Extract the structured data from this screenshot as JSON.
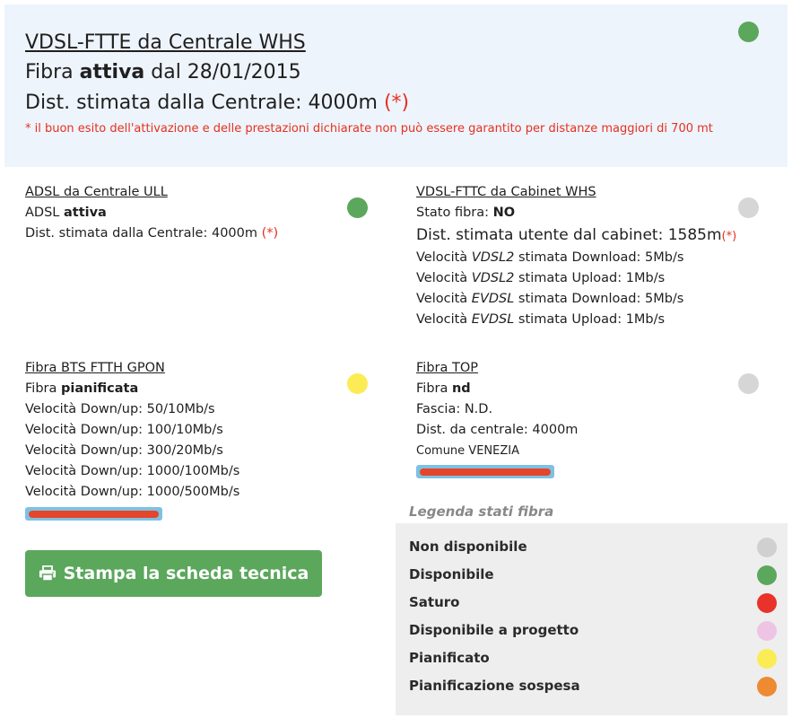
{
  "top": {
    "title": "VDSL-FTTE da Centrale WHS",
    "status_prefix": "Fibra ",
    "status_value": "attiva",
    "status_suffix": " dal 28/01/2015",
    "dist_label": "Dist. stimata dalla Centrale: 4000m ",
    "dist_mark": "(*)",
    "note": "* il buon esito dell'attivazione e delle prestazioni dichiarate non può essere garantito per distanze maggiori di 700 mt",
    "status_color": "#5ba75c"
  },
  "adsl": {
    "title": "ADSL da Centrale ULL",
    "status_prefix": "ADSL ",
    "status_value": "attiva",
    "dist_label": "Dist. stimata dalla Centrale: 4000m ",
    "dist_mark": "(*)",
    "status_color": "#5ba75c"
  },
  "vdsl": {
    "title": "VDSL-FTTC da Cabinet WHS",
    "status_prefix": "Stato fibra: ",
    "status_value": "NO",
    "dist_label": "Dist. stimata utente dal cabinet: 1585m",
    "dist_mark": "(*)",
    "speeds": [
      {
        "pre": "Velocità ",
        "tech": "VDSL2",
        "post": " stimata Download: 5Mb/s"
      },
      {
        "pre": "Velocità ",
        "tech": "VDSL2",
        "post": " stimata Upload: 1Mb/s"
      },
      {
        "pre": "Velocità ",
        "tech": "EVDSL",
        "post": " stimata Download: 5Mb/s"
      },
      {
        "pre": "Velocità ",
        "tech": "EVDSL",
        "post": " stimata Upload: 1Mb/s"
      }
    ],
    "status_color": "#d6d6d6"
  },
  "gpon": {
    "title": "Fibra BTS FTTH GPON",
    "status_prefix": "Fibra ",
    "status_value": "pianificata",
    "speeds": [
      "Velocità Down/up: 50/10Mb/s",
      "Velocità Down/up: 100/10Mb/s",
      "Velocità Down/up: 300/20Mb/s",
      "Velocità Down/up: 1000/100Mb/s",
      "Velocità Down/up: 1000/500Mb/s"
    ],
    "status_color": "#fbec55"
  },
  "top_fiber": {
    "title": "Fibra TOP",
    "status_prefix": "Fibra ",
    "status_value": "nd",
    "fascia": "Fascia: N.D.",
    "dist": "Dist. da centrale: 4000m",
    "comune": "Comune VENEZIA",
    "status_color": "#d6d6d6"
  },
  "print_button": {
    "label": "Stampa la scheda tecnica",
    "icon": "printer-icon"
  },
  "legend": {
    "title": "Legenda stati fibra",
    "items": [
      {
        "label": "Non disponibile",
        "color": "#d0d0d0"
      },
      {
        "label": "Disponibile",
        "color": "#5ba75c"
      },
      {
        "label": "Saturo",
        "color": "#e8322a"
      },
      {
        "label": "Disponibile a progetto",
        "color": "#eec4e4"
      },
      {
        "label": "Pianificato",
        "color": "#fbec55"
      },
      {
        "label": "Pianificazione sospesa",
        "color": "#ee8a32"
      }
    ]
  }
}
